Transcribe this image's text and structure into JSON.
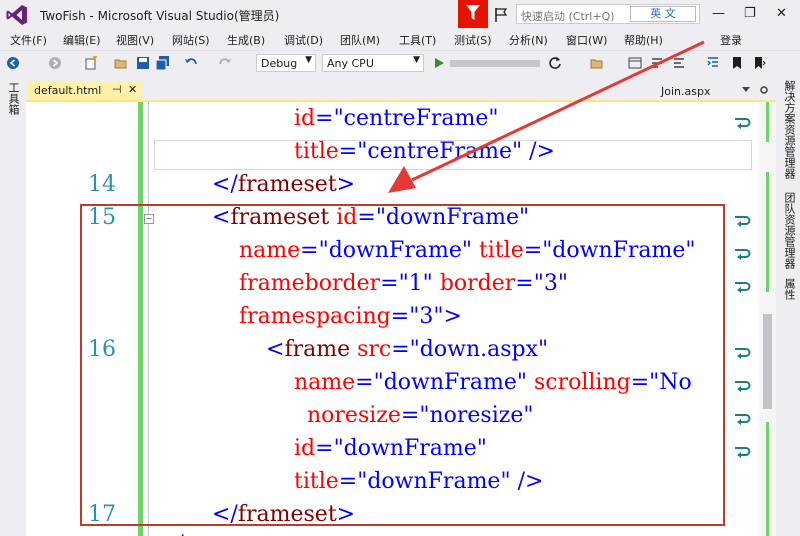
{
  "app": {
    "title": "TwoFish - Microsoft Visual Studio(管理员)"
  },
  "titlebar": {
    "quick_launch_placeholder": "快速启动 (Ctrl+Q)",
    "ime_label": "英 文",
    "minimize": "—",
    "restore": "❐",
    "close": "✕"
  },
  "menu": {
    "items": [
      "文件(F)",
      "编辑(E)",
      "视图(V)",
      "网站(S)",
      "生成(B)",
      "调试(D)",
      "团队(M)",
      "工具(T)",
      "测试(S)",
      "分析(N)",
      "窗口(W)",
      "帮助(H)"
    ],
    "login": "登录"
  },
  "toolbar": {
    "config": "Debug",
    "platform": "Any CPU"
  },
  "panels": {
    "left_toolbox": "工具箱",
    "right_solution": "解决方案资源管理器",
    "right_team": "团队资源管理器",
    "right_props": "属性"
  },
  "tabs": {
    "active": "default.html",
    "pin": "⊣",
    "close": "✕",
    "other": "Join.aspx"
  },
  "code": {
    "line_numbers": [
      "14",
      "15",
      "16",
      "17"
    ],
    "t": {
      "id": "id",
      "title": "title",
      "name": "name",
      "frameborder": "frameborder",
      "border": "border",
      "framespacing": "framespacing",
      "src": "src",
      "scrolling": "scrolling",
      "noresize": "noresize",
      "centreFrame": "\"centreFrame\"",
      "downFrame": "\"downFrame\"",
      "downAspx": "\"down.aspx\"",
      "no": "\"No",
      "noresizeVal": "\"noresize\"",
      "one": "\"1\"",
      "three": "\"3\"",
      "frameset": "frameset",
      "frame": "frame",
      "lt": "<",
      "ltslash": "</",
      "gt": ">",
      "slashgt": "/>",
      "eq": "="
    }
  },
  "colors": {
    "keyword": "#0000ff",
    "tag": "#800000",
    "attribute": "#ff0000",
    "line_number": "#2b91af",
    "highlight_box": "#c0392b",
    "arrow": "#e53935",
    "changed_bar": "#6fd46a",
    "accent": "#68217a"
  }
}
